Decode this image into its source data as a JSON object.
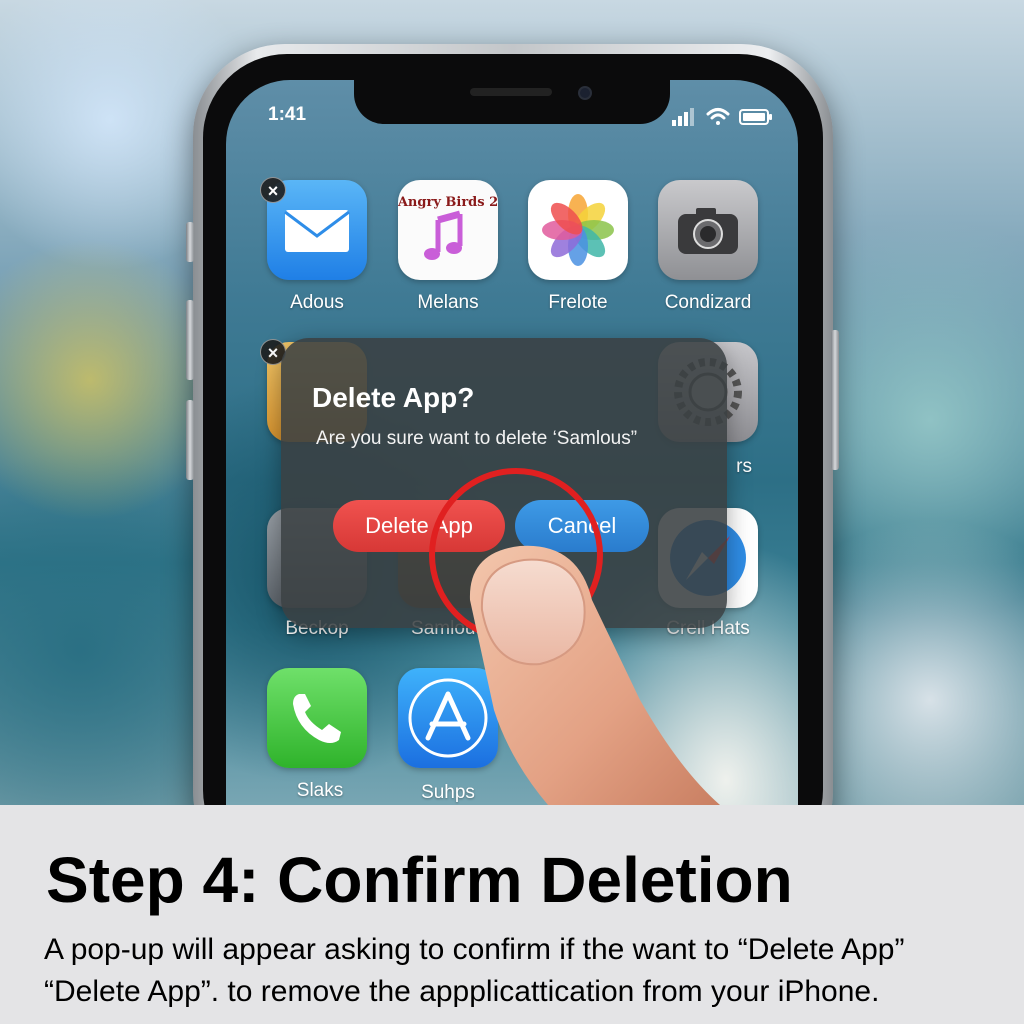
{
  "status_bar": {
    "time": "1:41"
  },
  "home_screen": {
    "row1": [
      {
        "label": "Adous",
        "icon": "mail-icon"
      },
      {
        "label": "Melans",
        "icon": "music-icon",
        "icon_text": "Angry Birds 2"
      },
      {
        "label": "Frelote",
        "icon": "photos-icon"
      },
      {
        "label": "Condizard",
        "icon": "camera-icon"
      }
    ],
    "row3": [
      {
        "label": "Beckop"
      },
      {
        "label": "Samlous"
      },
      {
        "label": "Crell Hats"
      }
    ],
    "row2_partial_label": "rs",
    "dock": [
      {
        "label": "Slaks",
        "icon": "phone-icon"
      },
      {
        "label": "Suhps",
        "icon": "app-store-icon"
      }
    ]
  },
  "dialog": {
    "title": "Delete App?",
    "message": "Are you sure want to delete ‘Samlous”",
    "delete_label": "Delete App",
    "cancel_label": "Cancel"
  },
  "caption": {
    "title": "Step 4: Confirm Deletion",
    "body": "A pop-up will appear asking to confirm if the want to “Delete App” “Delete App”. to remove the appplicattication from your iPhone."
  },
  "colors": {
    "delete_button": "#e0423f",
    "cancel_button": "#3189d8",
    "highlight_ring": "#e02020"
  }
}
